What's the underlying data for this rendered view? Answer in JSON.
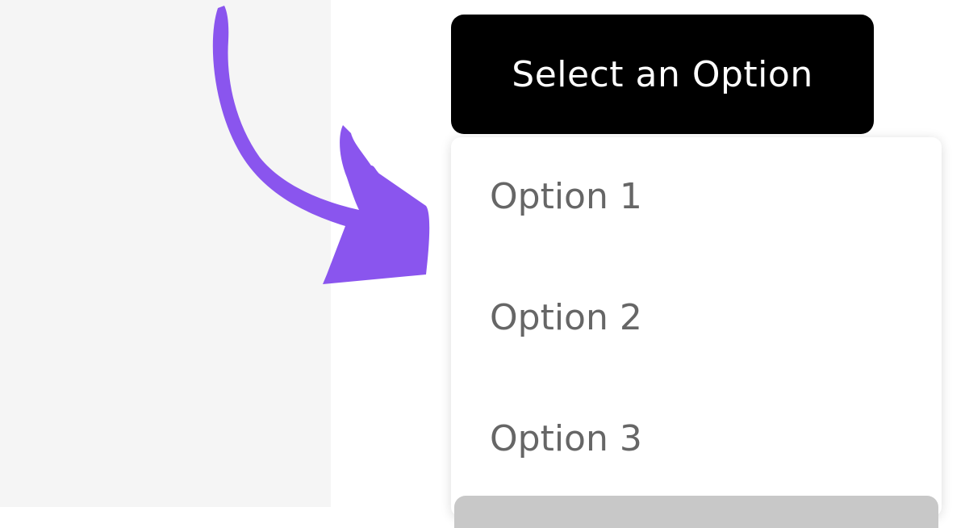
{
  "dropdown": {
    "button_label": "Select an Option",
    "items": [
      {
        "label": "Option 1"
      },
      {
        "label": "Option 2"
      },
      {
        "label": "Option 3"
      }
    ]
  },
  "colors": {
    "button_background": "#000000",
    "button_text": "#ffffff",
    "arrow": "#8a55ee",
    "item_text": "#666666",
    "left_panel": "#f5f5f5",
    "highlighted_item": "#c8c8c8"
  },
  "icons": {
    "pointer": "curved-arrow-icon"
  }
}
